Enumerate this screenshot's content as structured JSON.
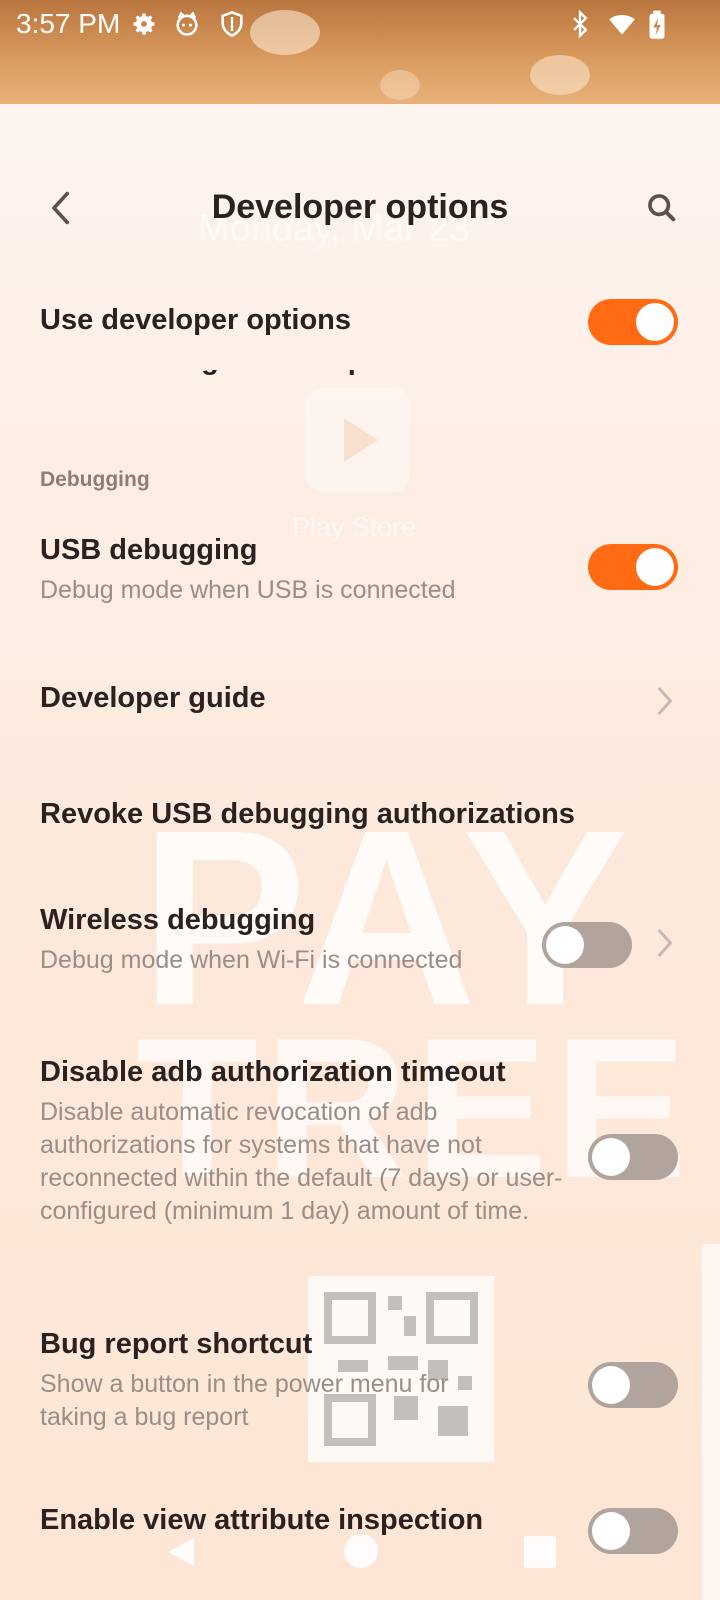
{
  "status_bar": {
    "time": "3:57 PM",
    "icons_left": [
      "gear-icon",
      "cat-face-icon",
      "shield-icon"
    ],
    "icons_right": [
      "bluetooth-icon",
      "wifi-icon",
      "battery-charging-icon"
    ]
  },
  "background_overlay": {
    "date": "Monday, Mar 23",
    "app_label": "Play Store",
    "watermark_line1": "PAY",
    "watermark_line2": "TREE"
  },
  "toolbar": {
    "title": "Developer options",
    "back_icon": "chevron-left-icon",
    "search_icon": "search-icon"
  },
  "main_toggle": {
    "label": "Use developer options",
    "enabled": true
  },
  "section_header": "Debugging",
  "items": [
    {
      "title": "USB debugging",
      "summary": "Debug mode when USB is connected",
      "control": "switch",
      "on": true
    },
    {
      "title": "Developer guide",
      "summary": "",
      "control": "chevron"
    },
    {
      "title": "Revoke USB debugging authorizations",
      "summary": "",
      "control": "none"
    },
    {
      "title": "Wireless debugging",
      "summary": "Debug mode when Wi-Fi is connected",
      "control": "switch+chevron",
      "on": false
    },
    {
      "title": "Disable adb authorization timeout",
      "summary": "Disable automatic revocation of adb authorizations for systems that have not reconnected within the default (7 days) or user-configured (minimum 1 day) amount of time.",
      "control": "switch",
      "on": false
    },
    {
      "title": "Bug report shortcut",
      "summary": "Show a button in the power menu for taking a bug report",
      "control": "switch",
      "on": false
    },
    {
      "title": "Enable view attribute inspection",
      "summary": "",
      "control": "switch",
      "on": false
    }
  ],
  "nav_bar": {
    "icons": [
      "back-triangle-icon",
      "home-circle-icon",
      "recents-square-icon"
    ]
  },
  "colors": {
    "accent": "#ff6a13",
    "switch_off": "#b1a49d",
    "title_text": "#2a2220",
    "summary_text": "#9a8e88"
  }
}
